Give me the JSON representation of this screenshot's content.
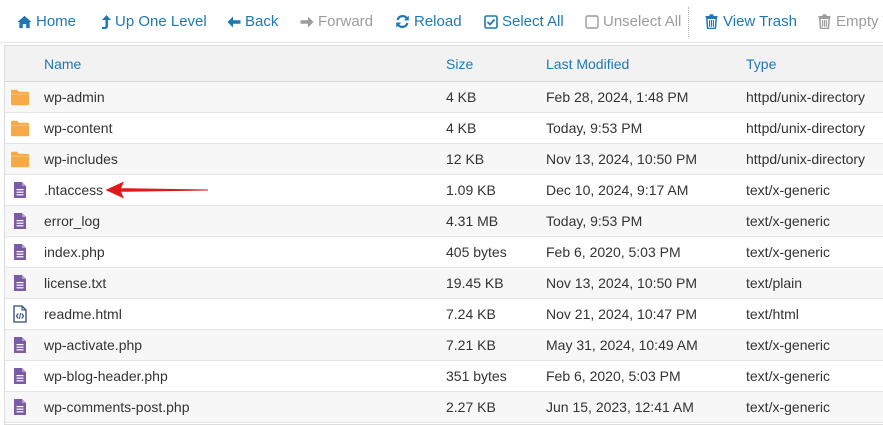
{
  "toolbar": {
    "buttons": [
      {
        "label": "Home",
        "icon": "home-icon",
        "state": "active"
      },
      {
        "label": "Up One Level",
        "icon": "up-arrow-icon",
        "state": "active"
      },
      {
        "label": "Back",
        "icon": "back-arrow-icon",
        "state": "active"
      },
      {
        "label": "Forward",
        "icon": "forward-arrow-icon",
        "state": "disabled"
      },
      {
        "label": "Reload",
        "icon": "reload-icon",
        "state": "active"
      },
      {
        "label": "Select All",
        "icon": "checkbox-checked-icon",
        "state": "active"
      },
      {
        "label": "Unselect All",
        "icon": "checkbox-empty-icon",
        "state": "disabled"
      },
      {
        "label": "View Trash",
        "icon": "trash-icon",
        "state": "active"
      },
      {
        "label": "Empty T",
        "icon": "trash-icon",
        "state": "disabled"
      }
    ]
  },
  "table": {
    "columns": [
      "Name",
      "Size",
      "Last Modified",
      "Type"
    ],
    "rows": [
      {
        "name": "wp-admin",
        "size": "4 KB",
        "modified": "Feb 28, 2024, 1:48 PM",
        "type": "httpd/unix-directory",
        "icon": "folder-icon"
      },
      {
        "name": "wp-content",
        "size": "4 KB",
        "modified": "Today, 9:53 PM",
        "type": "httpd/unix-directory",
        "icon": "folder-icon"
      },
      {
        "name": "wp-includes",
        "size": "12 KB",
        "modified": "Nov 13, 2024, 10:50 PM",
        "type": "httpd/unix-directory",
        "icon": "folder-icon"
      },
      {
        "name": ".htaccess",
        "size": "1.09 KB",
        "modified": "Dec 10, 2024, 9:17 AM",
        "type": "text/x-generic",
        "icon": "text-file-icon"
      },
      {
        "name": "error_log",
        "size": "4.31 MB",
        "modified": "Today, 9:53 PM",
        "type": "text/x-generic",
        "icon": "text-file-icon"
      },
      {
        "name": "index.php",
        "size": "405 bytes",
        "modified": "Feb 6, 2020, 5:03 PM",
        "type": "text/x-generic",
        "icon": "text-file-icon"
      },
      {
        "name": "license.txt",
        "size": "19.45 KB",
        "modified": "Nov 13, 2024, 10:50 PM",
        "type": "text/plain",
        "icon": "text-file-icon"
      },
      {
        "name": "readme.html",
        "size": "7.24 KB",
        "modified": "Nov 21, 2024, 10:47 PM",
        "type": "text/html",
        "icon": "html-file-icon"
      },
      {
        "name": "wp-activate.php",
        "size": "7.21 KB",
        "modified": "May 31, 2024, 10:49 AM",
        "type": "text/x-generic",
        "icon": "text-file-icon"
      },
      {
        "name": "wp-blog-header.php",
        "size": "351 bytes",
        "modified": "Feb 6, 2020, 5:03 PM",
        "type": "text/x-generic",
        "icon": "text-file-icon"
      },
      {
        "name": "wp-comments-post.php",
        "size": "2.27 KB",
        "modified": "Jun 15, 2023, 12:41 AM",
        "type": "text/x-generic",
        "icon": "text-file-icon"
      }
    ]
  },
  "colors": {
    "link_blue": "#1f78b4",
    "disabled_gray": "#9c9c9c",
    "folder_orange": "#f7a948",
    "file_purple": "#7b5aa6",
    "annotation_red": "#e0191b"
  }
}
